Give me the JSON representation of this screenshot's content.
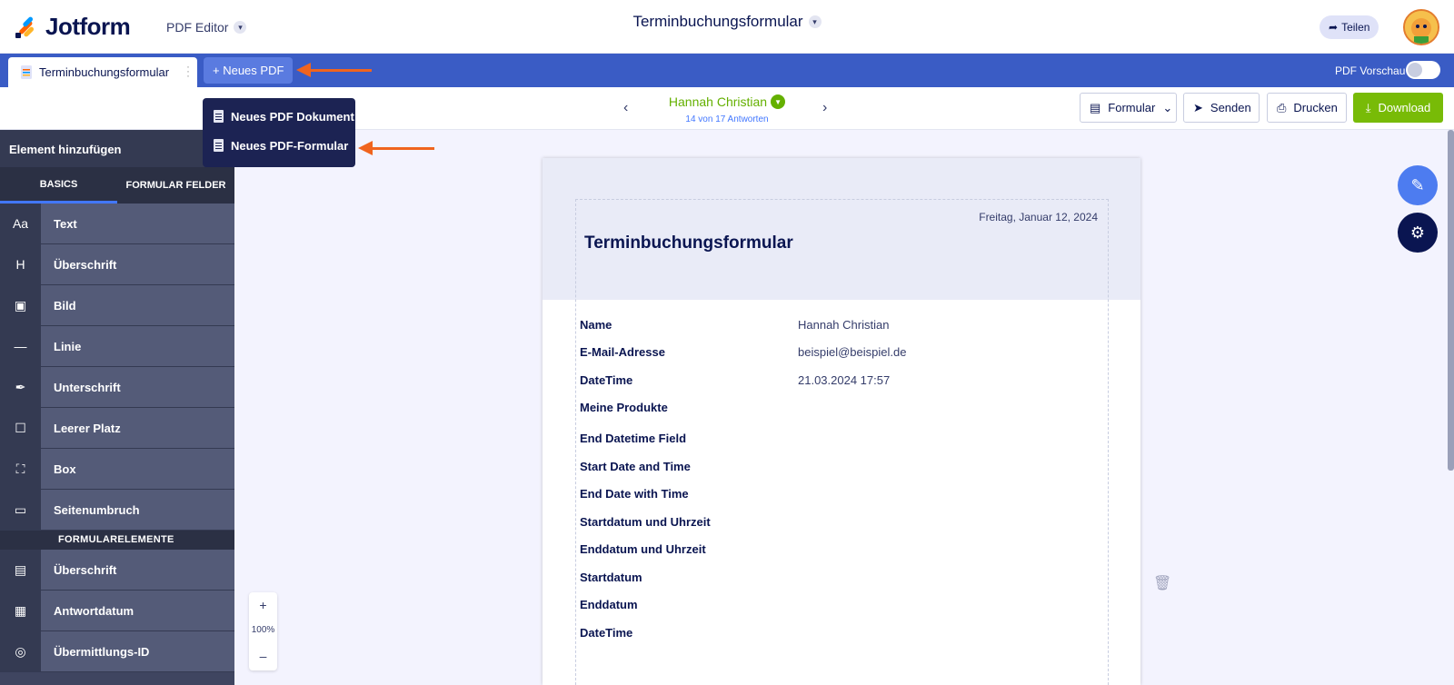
{
  "brand": {
    "name": "Jotform",
    "app_switcher": "PDF Editor"
  },
  "header": {
    "doc_title": "Terminbuchungsformular",
    "share_label": "Teilen"
  },
  "tabbar": {
    "tab_label": "Terminbuchungsformular",
    "new_pdf_label": "+ Neues PDF",
    "preview_label": "PDF Vorschau",
    "preview_on": false
  },
  "dropdown": {
    "items": [
      "Neues PDF Dokument",
      "Neues PDF-Formular"
    ]
  },
  "respondent": {
    "name": "Hannah Christian",
    "count": "14 von 17 Antworten"
  },
  "toolbar": {
    "form_label": "Formular",
    "send_label": "Senden",
    "print_label": "Drucken",
    "download_label": "Download"
  },
  "sidebar": {
    "title": "Element hinzufügen",
    "tabs": [
      "BASICS",
      "FORMULAR FELDER"
    ],
    "basics": [
      {
        "icon": "Aa",
        "label": "Text"
      },
      {
        "icon": "H",
        "label": "Überschrift"
      },
      {
        "icon": "▣",
        "label": "Bild"
      },
      {
        "icon": "—",
        "label": "Linie"
      },
      {
        "icon": "✒",
        "label": "Unterschrift"
      },
      {
        "icon": "☐",
        "label": "Leerer Platz"
      },
      {
        "icon": "⛶",
        "label": "Box"
      },
      {
        "icon": "▭",
        "label": "Seitenumbruch"
      }
    ],
    "section_label": "FORMULARELEMENTE",
    "form_elements": [
      {
        "icon": "▤",
        "label": "Überschrift"
      },
      {
        "icon": "▦",
        "label": "Antwortdatum"
      },
      {
        "icon": "◎",
        "label": "Übermittlungs-ID"
      }
    ]
  },
  "page": {
    "date": "Freitag, Januar 12, 2024",
    "title": "Terminbuchungsformular",
    "fields": [
      {
        "label": "Name",
        "value": "Hannah Christian"
      },
      {
        "label": "E-Mail-Adresse",
        "value": "beispiel@beispiel.de"
      },
      {
        "label": "DateTime",
        "value": "21.03.2024 17:57"
      },
      {
        "label": "Meine Produkte",
        "value": ""
      },
      {
        "label": "End Datetime Field",
        "value": ""
      },
      {
        "label": "Start Date and Time",
        "value": ""
      },
      {
        "label": "End Date with Time",
        "value": ""
      },
      {
        "label": "Startdatum und Uhrzeit",
        "value": ""
      },
      {
        "label": "Enddatum und Uhrzeit",
        "value": ""
      },
      {
        "label": "Startdatum",
        "value": ""
      },
      {
        "label": "Enddatum",
        "value": ""
      },
      {
        "label": "DateTime",
        "value": ""
      }
    ]
  },
  "zoom": {
    "in": "+",
    "level": "100%",
    "out": "–"
  },
  "colors": {
    "tabbar": "#3a5cc5",
    "download": "#78bb07",
    "accent_arrow": "#f0641e",
    "respondent": "#64b000"
  }
}
